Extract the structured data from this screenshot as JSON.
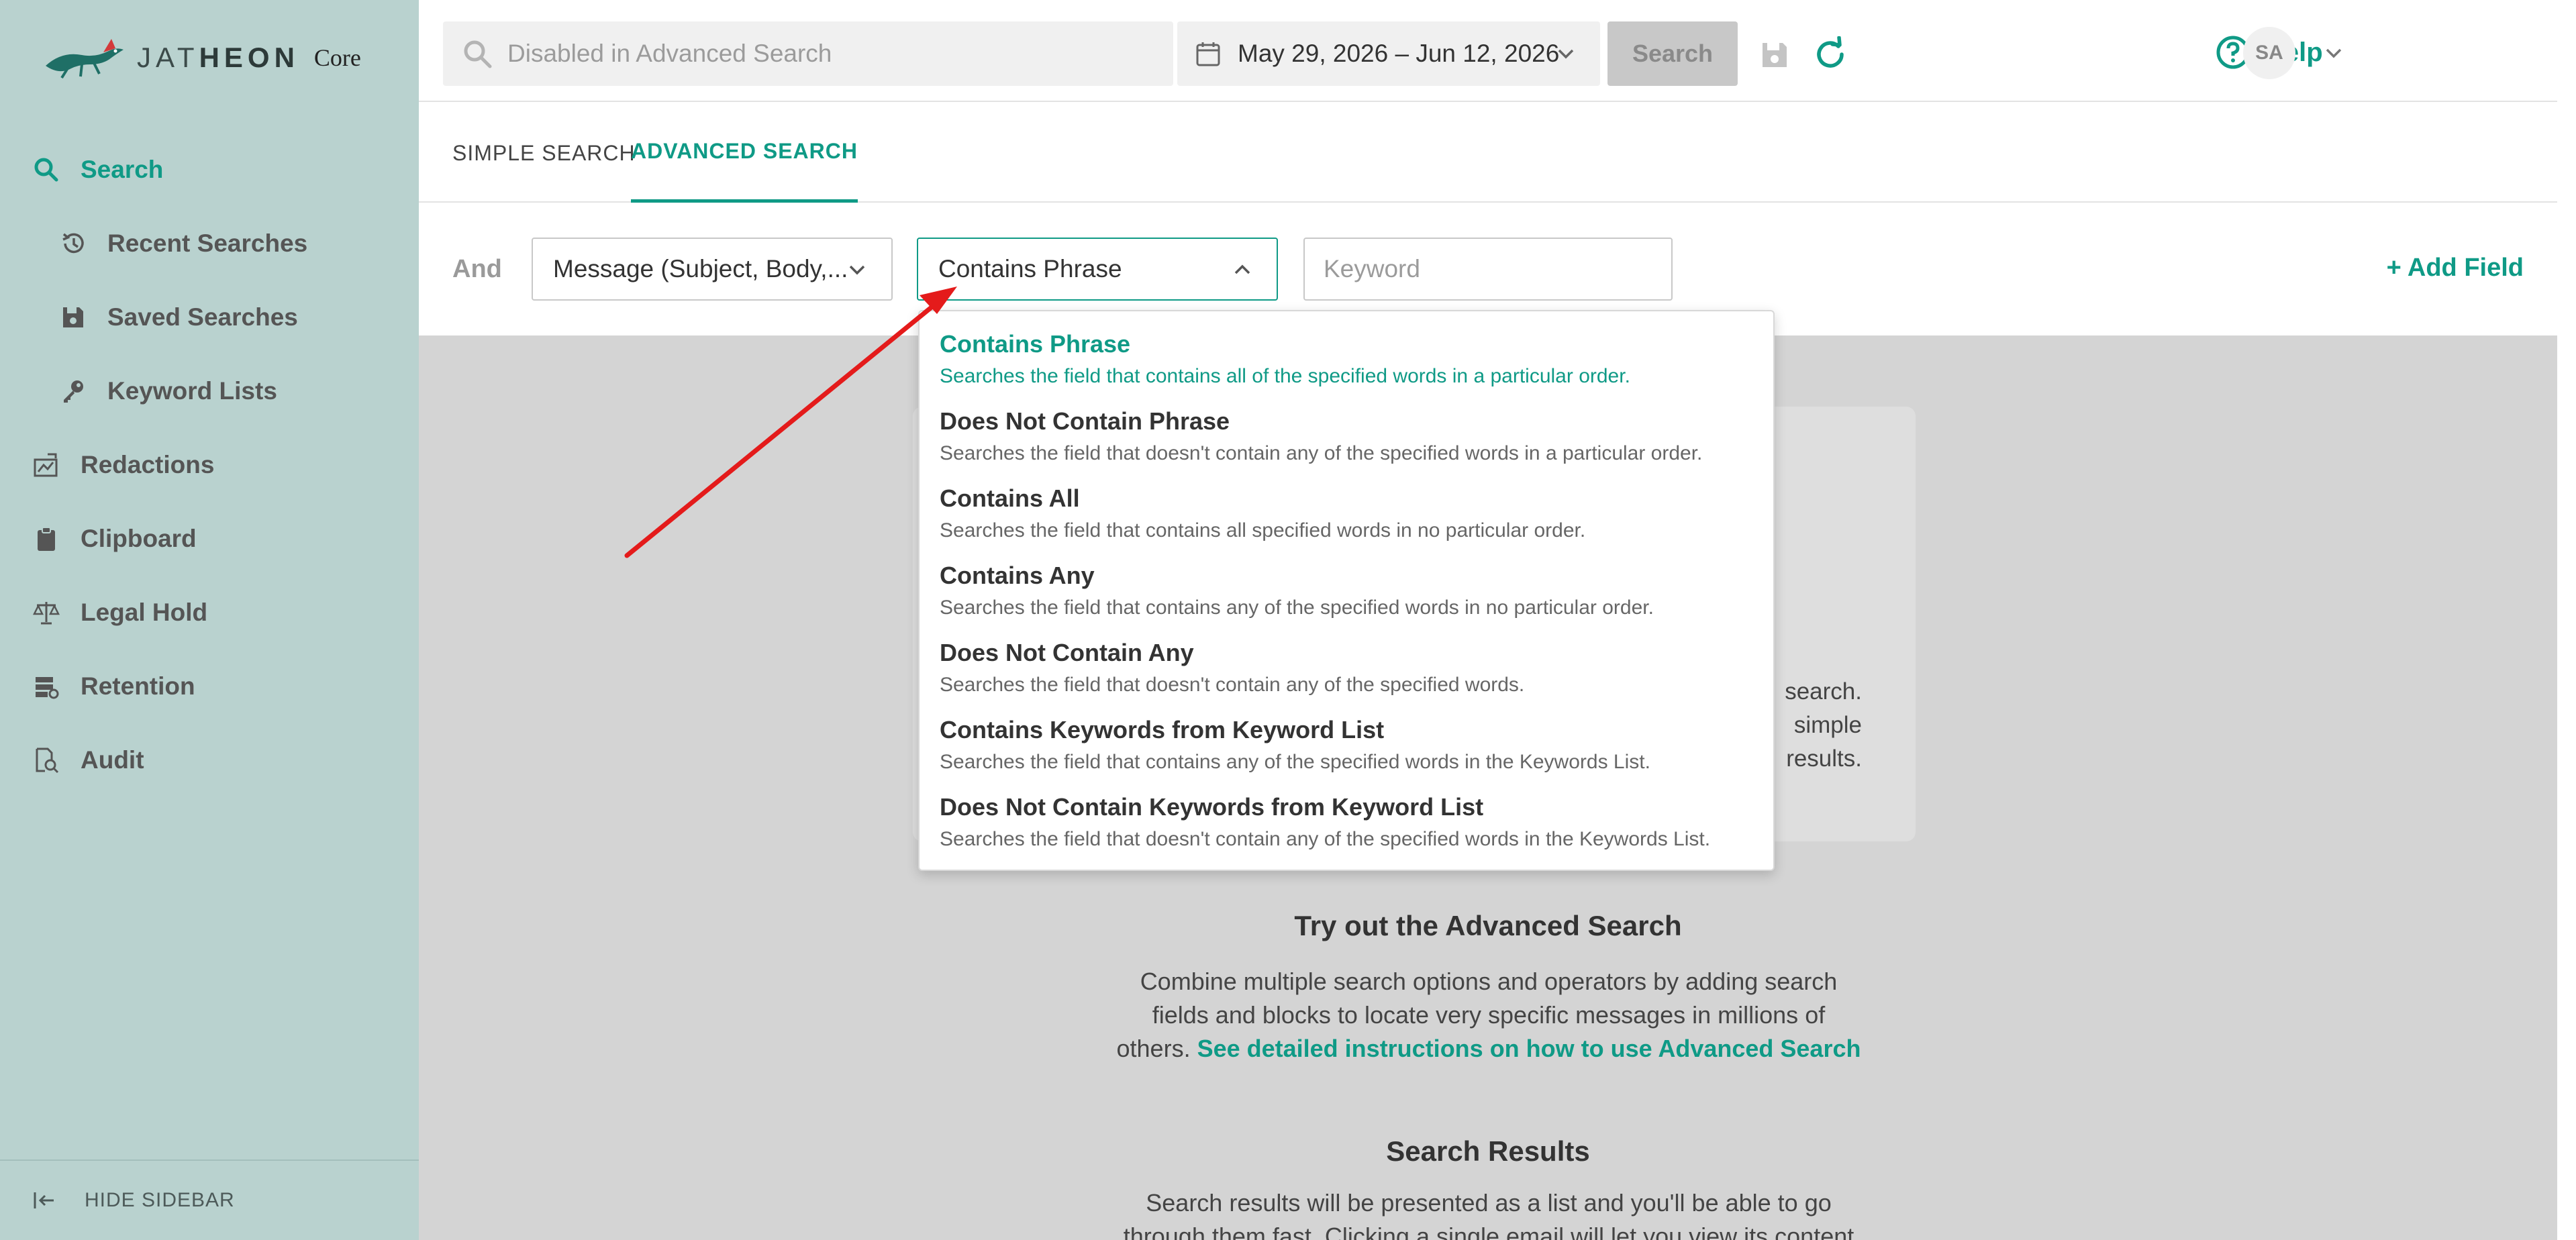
{
  "brand": {
    "name_light": "JAT",
    "name_bold": "HEON",
    "product": "Core"
  },
  "sidebar": {
    "search": "Search",
    "recent_searches": "Recent Searches",
    "saved_searches": "Saved Searches",
    "keyword_lists": "Keyword Lists",
    "redactions": "Redactions",
    "clipboard": "Clipboard",
    "legal_hold": "Legal Hold",
    "retention": "Retention",
    "audit": "Audit",
    "hide_sidebar": "HIDE SIDEBAR"
  },
  "topbar": {
    "search_placeholder": "Disabled in Advanced Search",
    "date_range": "May 29, 2026 – Jun 12, 2026",
    "search_button": "Search",
    "help": "Help",
    "avatar_initials": "SA"
  },
  "tabs": {
    "simple": "SIMPLE SEARCH",
    "advanced": "ADVANCED SEARCH"
  },
  "query": {
    "and": "And",
    "field": "Message (Subject, Body,...",
    "operator": "Contains Phrase",
    "keyword_placeholder": "Keyword",
    "add_field": "+ Add Field"
  },
  "dropdown_options": [
    {
      "label": "Contains Phrase",
      "desc": "Searches the field that contains all of the specified words in a particular order.",
      "selected": true
    },
    {
      "label": "Does Not Contain Phrase",
      "desc": "Searches the field that doesn't contain any of the specified words in a particular order."
    },
    {
      "label": "Contains All",
      "desc": "Searches the field that contains all specified words in no particular order."
    },
    {
      "label": "Contains Any",
      "desc": "Searches the field that contains any of the specified words in no particular order."
    },
    {
      "label": "Does Not Contain Any",
      "desc": "Searches the field that doesn't contain any of the specified words."
    },
    {
      "label": "Contains Keywords from Keyword List",
      "desc": "Searches the field that contains any of the specified words in the Keywords List."
    },
    {
      "label": "Does Not Contain Keywords from Keyword List",
      "desc": "Searches the field that doesn't contain any of the specified words in the Keywords List."
    }
  ],
  "card": {
    "line1": "search.",
    "line2": "simple",
    "line3": "results."
  },
  "info": {
    "advanced_title": "Try out the Advanced Search",
    "advanced_line1": "Combine multiple search options and operators by adding search",
    "advanced_line2": "fields and blocks to locate very specific messages in millions of",
    "advanced_line3_prefix": "others. ",
    "advanced_link": "See detailed instructions on how to use Advanced Search",
    "results_title": "Search Results",
    "results_line1": "Search results will be presented as a list and you'll be able to go",
    "results_line2": "through them fast. Clicking a single email will let you view its content"
  },
  "colors": {
    "accent": "#0f9a86",
    "sidebar_bg": "#b9d2cf",
    "annotation_arrow": "#e41b1b"
  },
  "icons": [
    "search-icon",
    "history-icon",
    "save-icon",
    "key-icon",
    "redaction-icon",
    "clipboard-icon",
    "scale-icon",
    "retention-icon",
    "audit-icon",
    "calendar-icon",
    "refresh-icon",
    "help-icon",
    "chevron-down-icon",
    "chevron-up-icon",
    "collapse-icon"
  ]
}
